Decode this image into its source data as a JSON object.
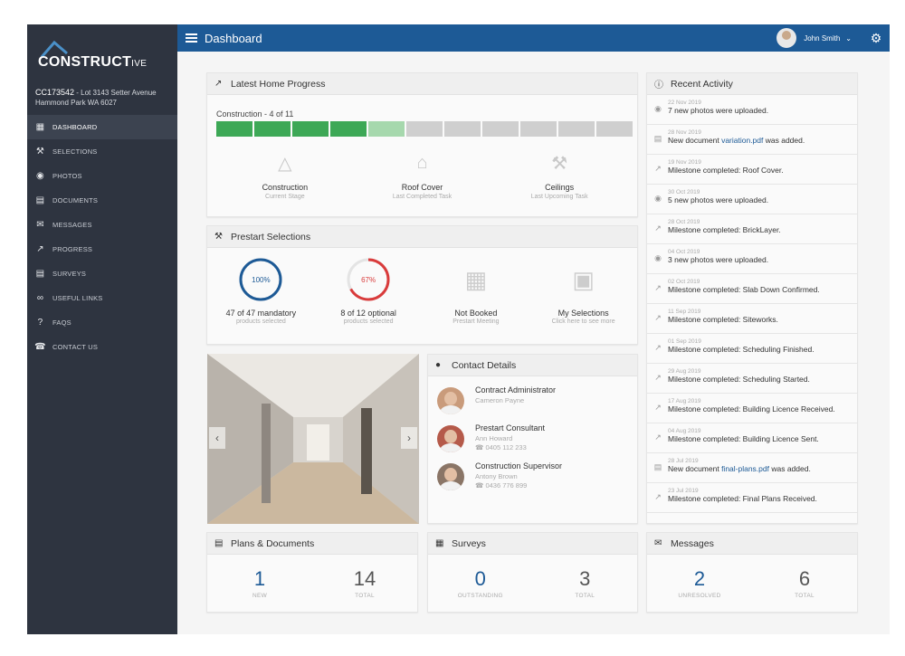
{
  "brand": {
    "main": "CONSTRUCT",
    "suffix": "IVE"
  },
  "job": {
    "code": "CC173542",
    "address_line1": " - Lot 3143 Setter Avenue",
    "address_line2": "Hammond Park WA 6027"
  },
  "nav": [
    {
      "label": "Dashboard",
      "icon": "dashboard-icon",
      "active": true
    },
    {
      "label": "Selections",
      "icon": "selections-icon"
    },
    {
      "label": "Photos",
      "icon": "camera-icon"
    },
    {
      "label": "Documents",
      "icon": "document-icon"
    },
    {
      "label": "Messages",
      "icon": "envelope-icon"
    },
    {
      "label": "Progress",
      "icon": "trend-icon"
    },
    {
      "label": "Surveys",
      "icon": "clipboard-icon"
    },
    {
      "label": "Useful Links",
      "icon": "link-icon"
    },
    {
      "label": "FAQs",
      "icon": "question-icon"
    },
    {
      "label": "Contact Us",
      "icon": "phone-icon"
    }
  ],
  "topbar": {
    "title": "Dashboard",
    "user": "John Smith"
  },
  "progress": {
    "title": "Latest Home Progress",
    "label": "Construction - 4 of 11",
    "total_segments": 11,
    "completed": 4,
    "current": 1,
    "stages": [
      {
        "title": "Construction",
        "subtitle": "Current Stage",
        "icon": "hard-hat-icon"
      },
      {
        "title": "Roof Cover",
        "subtitle": "Last Completed Task",
        "icon": "house-icon"
      },
      {
        "title": "Ceilings",
        "subtitle": "Last Upcoming Task",
        "icon": "tools-icon"
      }
    ]
  },
  "selections": {
    "title": "Prestart Selections",
    "items": [
      {
        "ring": "100%",
        "percent": 100,
        "color": "#1d5a96",
        "title": "47 of 47 mandatory",
        "subtitle": "products selected"
      },
      {
        "ring": "67%",
        "percent": 67,
        "color": "#d93b3b",
        "title": "8 of 12 optional",
        "subtitle": "products selected"
      },
      {
        "title": "Not Booked",
        "subtitle": "Prestart Meeting",
        "icon": "calendar-icon"
      },
      {
        "title": "My Selections",
        "subtitle": "Click here to see more",
        "icon": "shopping-bag-icon"
      }
    ]
  },
  "contacts": {
    "title": "Contact Details",
    "items": [
      {
        "role": "Contract Administrator",
        "name": "Cameron Payne",
        "phone": ""
      },
      {
        "role": "Prestart Consultant",
        "name": "Ann Howard",
        "phone": "0405 112 233"
      },
      {
        "role": "Construction Supervisor",
        "name": "Antony Brown",
        "phone": "0436 776 899"
      }
    ]
  },
  "plans": {
    "title": "Plans & Documents",
    "stats": [
      {
        "value": "1",
        "label": "NEW"
      },
      {
        "value": "14",
        "label": "TOTAL"
      }
    ]
  },
  "surveys": {
    "title": "Surveys",
    "stats": [
      {
        "value": "0",
        "label": "OUTSTANDING"
      },
      {
        "value": "3",
        "label": "TOTAL"
      }
    ]
  },
  "messages": {
    "title": "Messages",
    "stats": [
      {
        "value": "2",
        "label": "UNRESOLVED"
      },
      {
        "value": "6",
        "label": "TOTAL"
      }
    ]
  },
  "activity": {
    "title": "Recent Activity",
    "items": [
      {
        "date": "22 Nov 2019",
        "text": "7 new photos were uploaded.",
        "icon": "camera-icon"
      },
      {
        "date": "28 Nov 2019",
        "text": "New document ",
        "link": "variation.pdf",
        "after": " was added.",
        "icon": "document-icon"
      },
      {
        "date": "19 Nov 2019",
        "text": "Milestone completed: Roof Cover.",
        "icon": "trend-icon"
      },
      {
        "date": "30 Oct 2019",
        "text": "5 new photos were uploaded.",
        "icon": "camera-icon"
      },
      {
        "date": "28 Oct 2019",
        "text": "Milestone completed: BrickLayer.",
        "icon": "trend-icon"
      },
      {
        "date": "04 Oct 2019",
        "text": "3 new photos were uploaded.",
        "icon": "camera-icon"
      },
      {
        "date": "02 Oct 2019",
        "text": "Milestone completed: Slab Down Confirmed.",
        "icon": "trend-icon"
      },
      {
        "date": "11 Sep 2019",
        "text": "Milestone completed: Siteworks.",
        "icon": "trend-icon"
      },
      {
        "date": "01 Sep 2019",
        "text": "Milestone completed: Scheduling Finished.",
        "icon": "trend-icon"
      },
      {
        "date": "29 Aug 2019",
        "text": "Milestone completed: Scheduling Started.",
        "icon": "trend-icon"
      },
      {
        "date": "17 Aug 2019",
        "text": "Milestone completed: Building Licence Received.",
        "icon": "trend-icon"
      },
      {
        "date": "04 Aug 2019",
        "text": "Milestone completed: Building Licence Sent.",
        "icon": "trend-icon"
      },
      {
        "date": "28 Jul 2019",
        "text": "New document ",
        "link": "final-plans.pdf",
        "after": " was added.",
        "icon": "document-icon"
      },
      {
        "date": "23 Jul 2019",
        "text": "Milestone completed: Final Plans Received.",
        "icon": "trend-icon"
      }
    ]
  }
}
